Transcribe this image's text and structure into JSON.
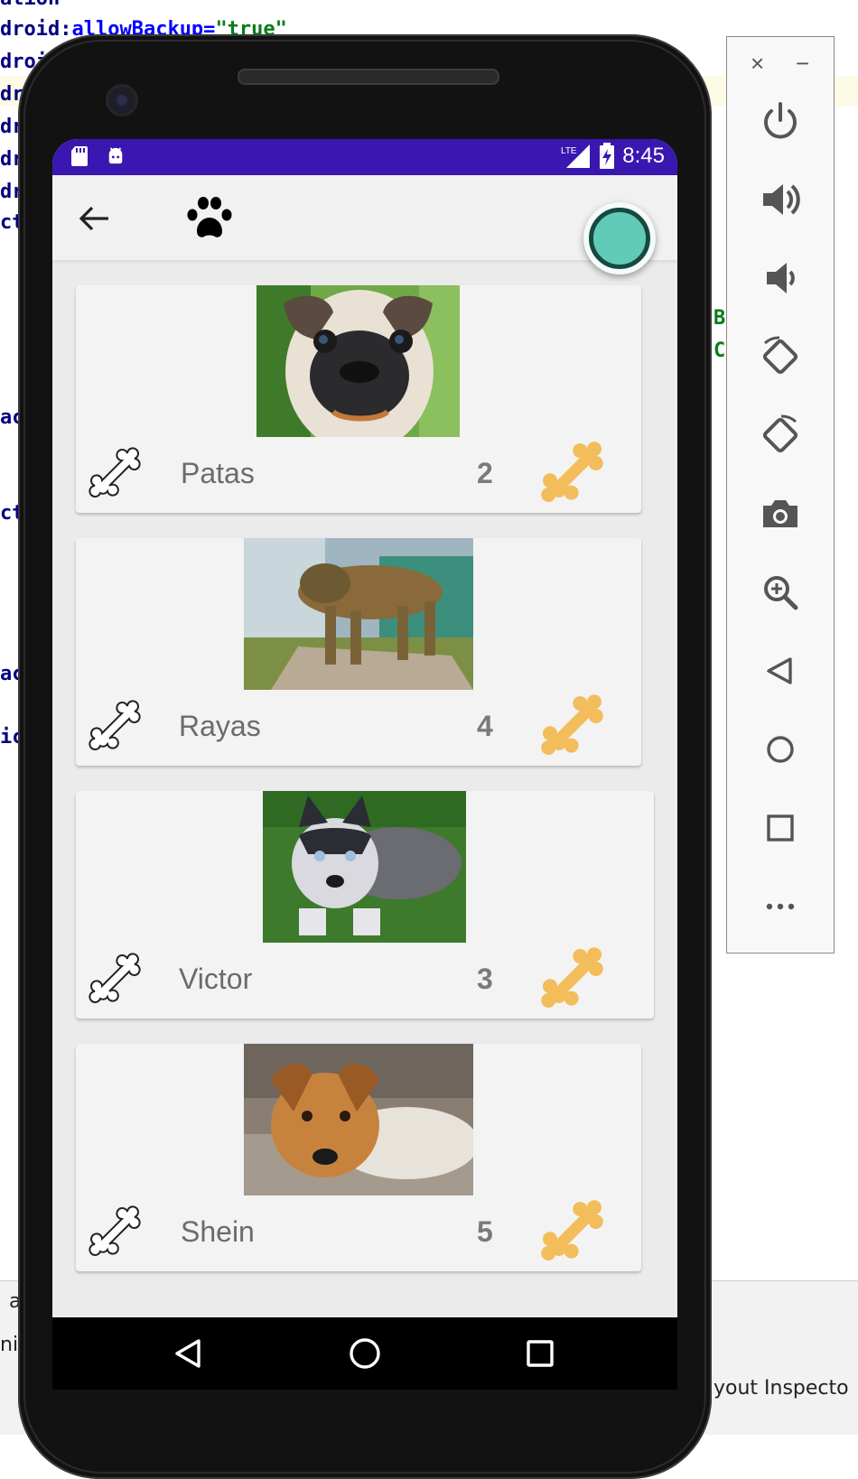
{
  "ide": {
    "code_lines": [
      {
        "prefix": "ation",
        "attr": "",
        "value": ""
      },
      {
        "prefix": "droid:",
        "attr": "allowBackup=",
        "value": "\"true\""
      },
      {
        "prefix": "droi",
        "attr": "",
        "value": ""
      },
      {
        "prefix": "dro",
        "attr": "",
        "value": ""
      },
      {
        "prefix": "dro",
        "attr": "",
        "value": ""
      },
      {
        "prefix": "dro",
        "attr": "",
        "value": ""
      },
      {
        "prefix": "dro",
        "attr": "",
        "value": ""
      },
      {
        "prefix": "ct",
        "attr": "",
        "value": ""
      }
    ],
    "side_fragments": [
      "ac",
      "ct",
      "ac",
      "ic"
    ],
    "green_fragments": [
      "B",
      "C"
    ],
    "bottom_fragments": [
      "a",
      "ni",
      "yout Inspecto"
    ]
  },
  "status_bar": {
    "time": "8:45",
    "network_label": "LTE",
    "color": "#3a17b0"
  },
  "app_bar": {
    "back_icon": "arrow-left-icon",
    "logo_icon": "paw-icon"
  },
  "fab": {
    "icon": "record-circle-icon",
    "color": "#62cbb7"
  },
  "pets": [
    {
      "name": "Patas",
      "count": "2",
      "photo": "pug puppy"
    },
    {
      "name": "Rayas",
      "count": "4",
      "photo": "brindle dog"
    },
    {
      "name": "Victor",
      "count": "3",
      "photo": "husky puppy"
    },
    {
      "name": "Shein",
      "count": "5",
      "photo": "brown puppy"
    }
  ],
  "colors": {
    "accent_bone": "#f2bd5a",
    "teal": "#62cbb7"
  },
  "nav_bar": {
    "back_icon": "triangle-back-icon",
    "home_icon": "circle-home-icon",
    "recents_icon": "square-recents-icon"
  },
  "emulator_toolbar": {
    "close_label": "×",
    "minimize_label": "−",
    "buttons": [
      "power-icon",
      "volume-up-icon",
      "volume-down-icon",
      "rotate-left-icon",
      "rotate-right-icon",
      "camera-icon",
      "zoom-icon",
      "back-icon",
      "home-icon",
      "overview-icon",
      "more-icon"
    ]
  }
}
